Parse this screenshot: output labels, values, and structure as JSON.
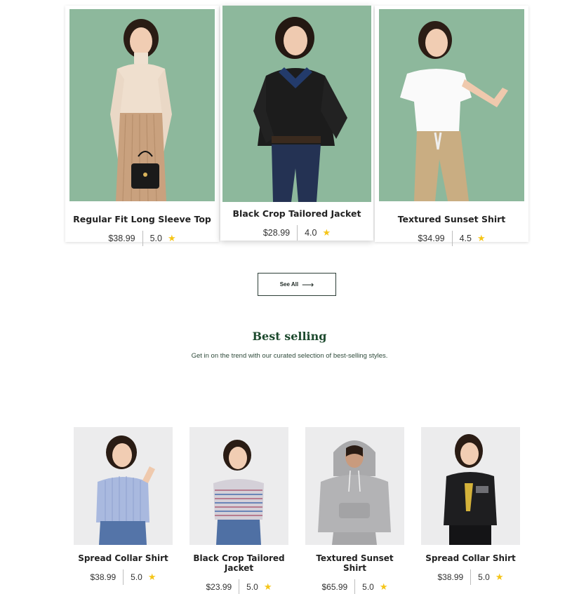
{
  "featured": [
    {
      "name": "Regular Fit Long Sleeve Top",
      "price": "$38.99",
      "rating": "5.0",
      "image": "woman in cream turtleneck and ribbed beige skirt"
    },
    {
      "name": "Black Crop Tailored Jacket",
      "price": "$28.99",
      "rating": "4.0",
      "image": "woman in black leather jacket and jeans"
    },
    {
      "name": "Textured Sunset Shirt",
      "price": "$34.99",
      "rating": "4.5",
      "image": "woman in white tee and khaki cargo pants"
    }
  ],
  "see_all": {
    "label": "See All",
    "arrow": "⟶"
  },
  "best_selling": {
    "title": "Best selling",
    "subtitle": "Get in on the trend with our curated selection of best-selling styles.",
    "products": [
      {
        "name": "Spread Collar Shirt",
        "price": "$38.99",
        "rating": "5.0",
        "image": "woman in striped blue shirt"
      },
      {
        "name": "Black Crop Tailored Jacket",
        "price": "$23.99",
        "rating": "5.0",
        "image": "woman in striped tee and jeans"
      },
      {
        "name": "Textured Sunset Shirt",
        "price": "$65.99",
        "rating": "5.0",
        "image": "woman in grey hoodie"
      },
      {
        "name": "Spread Collar Shirt",
        "price": "$38.99",
        "rating": "5.0",
        "image": "woman in black graphic sweatshirt"
      }
    ]
  },
  "star_icon": "★",
  "colors": {
    "card_bg": "#8db89c",
    "accent_star": "#f5c518",
    "heading": "#1d4a2e"
  }
}
